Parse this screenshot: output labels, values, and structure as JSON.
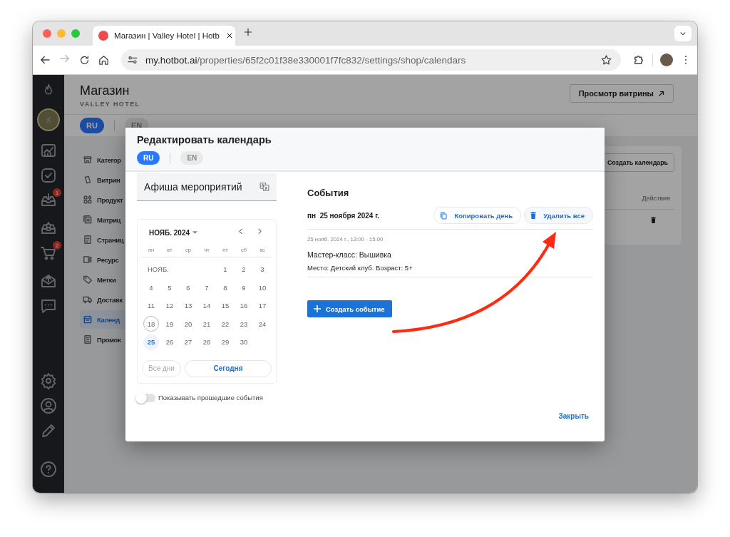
{
  "browser": {
    "tab": {
      "title": "Магазин | Valley Hotel | Hotb"
    },
    "address": {
      "host": "my.hotbot.ai",
      "path": "/properties/65f2c01f38e330001f7fc832/settings/shop/calendars"
    }
  },
  "sidebar": {
    "inbox_badge": "1",
    "cart_badge": "2"
  },
  "page": {
    "title": "Магазин",
    "subtitle": "VALLEY HOTEL",
    "preview_button": "Просмотр витрины",
    "languages": [
      {
        "label": "RU",
        "selected": true
      },
      {
        "label": "EN",
        "selected": false
      }
    ],
    "nav": [
      {
        "label": "Категор",
        "selected": false
      },
      {
        "label": "Витрин",
        "selected": false
      },
      {
        "label": "Продукт",
        "selected": false
      },
      {
        "label": "Матриц",
        "selected": false
      },
      {
        "label": "Страниц",
        "selected": false
      },
      {
        "label": "Ресурс",
        "selected": false
      },
      {
        "label": "Метки",
        "selected": false
      },
      {
        "label": "Доставк",
        "selected": false
      },
      {
        "label": "Календ",
        "selected": true
      },
      {
        "label": "Промок",
        "selected": false
      }
    ],
    "create_button": "Создать календарь",
    "table": {
      "columns": [
        "Действия"
      ]
    }
  },
  "modal": {
    "title": "Редактировать календарь",
    "languages": [
      {
        "label": "RU",
        "selected": true
      },
      {
        "label": "EN",
        "selected": false
      }
    ],
    "name_field": {
      "value": "Афиша мероприятий"
    },
    "calendar": {
      "month": "НОЯБ. 2024",
      "weekdays": [
        "пн",
        "вт",
        "ср",
        "чт",
        "пт",
        "сб",
        "вс"
      ],
      "weeks": [
        {
          "label": "НОЯБ.",
          "days": [
            {
              "d": "1",
              "today": false,
              "selected": false
            },
            {
              "d": "2",
              "today": false,
              "selected": false
            },
            {
              "d": "3",
              "today": false,
              "selected": false
            }
          ]
        },
        {
          "days": [
            {
              "d": "4",
              "today": false,
              "selected": false
            },
            {
              "d": "5",
              "today": false,
              "selected": false
            },
            {
              "d": "6",
              "today": false,
              "selected": false
            },
            {
              "d": "7",
              "today": false,
              "selected": false
            },
            {
              "d": "8",
              "today": false,
              "selected": false
            },
            {
              "d": "9",
              "today": false,
              "selected": false
            },
            {
              "d": "10",
              "today": false,
              "selected": false
            }
          ]
        },
        {
          "days": [
            {
              "d": "11",
              "today": false,
              "selected": false
            },
            {
              "d": "12",
              "today": false,
              "selected": false
            },
            {
              "d": "13",
              "today": false,
              "selected": false
            },
            {
              "d": "14",
              "today": false,
              "selected": false
            },
            {
              "d": "15",
              "today": false,
              "selected": false
            },
            {
              "d": "16",
              "today": false,
              "selected": false
            },
            {
              "d": "17",
              "today": false,
              "selected": false
            }
          ]
        },
        {
          "days": [
            {
              "d": "18",
              "today": true,
              "selected": false
            },
            {
              "d": "19",
              "today": false,
              "selected": false
            },
            {
              "d": "20",
              "today": false,
              "selected": false
            },
            {
              "d": "21",
              "today": false,
              "selected": false
            },
            {
              "d": "22",
              "today": false,
              "selected": false
            },
            {
              "d": "23",
              "today": false,
              "selected": false
            },
            {
              "d": "24",
              "today": false,
              "selected": false
            }
          ]
        },
        {
          "days": [
            {
              "d": "25",
              "today": false,
              "selected": true
            },
            {
              "d": "26",
              "today": false,
              "selected": false
            },
            {
              "d": "27",
              "today": false,
              "selected": false
            },
            {
              "d": "28",
              "today": false,
              "selected": false
            },
            {
              "d": "29",
              "today": false,
              "selected": false
            },
            {
              "d": "30",
              "today": false,
              "selected": false
            }
          ]
        }
      ],
      "buttons": [
        {
          "label": "Все дни",
          "kind": "secondary"
        },
        {
          "label": "Сегодня",
          "kind": "primary"
        }
      ]
    },
    "show_past": {
      "label": "Показывать прошедшие события",
      "on": false
    },
    "events_title": "События",
    "day": "пн  25 ноября 2024 г.",
    "day_actions": [
      {
        "label": "Копировать день",
        "kind": "copy"
      },
      {
        "label": "Удалить все",
        "kind": "delete"
      }
    ],
    "events": [
      {
        "time": "25 нояб. 2024 г., 13:00 - 15:00",
        "title": "Мастер-класс: Вышивка",
        "details": "Место: Детский клуб. Возраст: 5+"
      }
    ],
    "create_button": "Создать событие",
    "close_link": "Закрыть"
  },
  "annotations": [
    {
      "kind": "curved-arrow"
    }
  ]
}
